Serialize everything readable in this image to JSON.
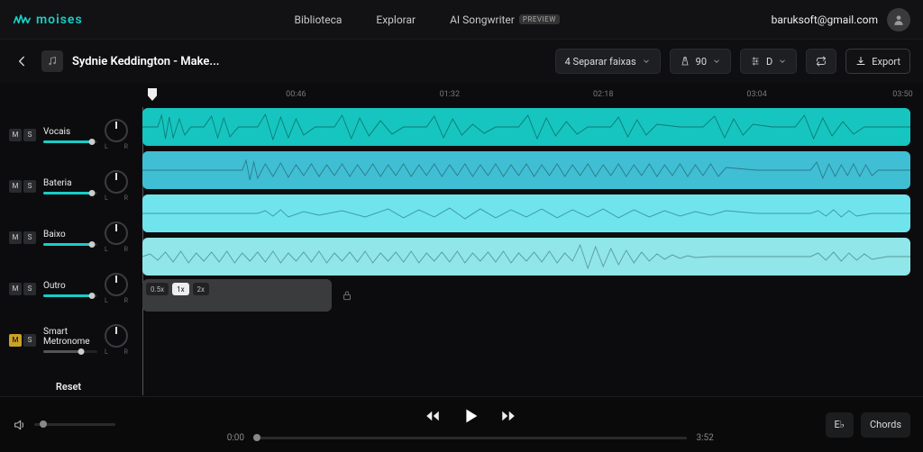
{
  "brand": {
    "name": "moises"
  },
  "nav": {
    "library": "Biblioteca",
    "explore": "Explorar",
    "songwriter": "AI Songwriter",
    "preview_badge": "PREVIEW"
  },
  "user": {
    "email": "baruksoft@gmail.com"
  },
  "toolbar": {
    "song_title": "Sydnie Keddington - Make...",
    "separate_label": "4 Separar faixas",
    "tempo_value": "90",
    "key_value": "D",
    "export_label": "Export"
  },
  "timeline": {
    "marks": [
      "00:46",
      "01:32",
      "02:18",
      "03:04",
      "03:50"
    ]
  },
  "tracks": [
    {
      "name": "Vocais",
      "volume": 0.9
    },
    {
      "name": "Bateria",
      "volume": 0.9
    },
    {
      "name": "Baixo",
      "volume": 0.9
    },
    {
      "name": "Outro",
      "volume": 0.9
    }
  ],
  "metronome": {
    "name_line1": "Smart",
    "name_line2": "Metronome",
    "speed_options": [
      "0.5x",
      "1x",
      "2x"
    ],
    "active_speed_index": 1,
    "mute_active": true
  },
  "sidebar": {
    "reset_label": "Reset"
  },
  "player": {
    "current_time": "0:00",
    "total_time": "3:52",
    "eb_label": "E♭",
    "chords_label": "Chords"
  }
}
